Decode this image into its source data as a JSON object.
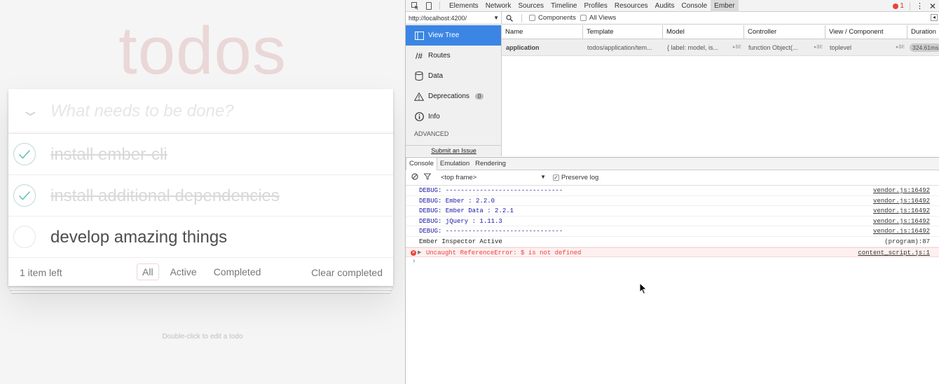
{
  "todo": {
    "title": "todos",
    "new_placeholder": "What needs to be done?",
    "items": [
      {
        "label": "install ember-cli",
        "completed": true
      },
      {
        "label": "install additional dependencies",
        "completed": true
      },
      {
        "label": "develop amazing things",
        "completed": false
      }
    ],
    "items_left": "1 item left",
    "filters": [
      "All",
      "Active",
      "Completed"
    ],
    "selected_filter": "All",
    "clear_completed": "Clear completed",
    "info": "Double-click to edit a todo"
  },
  "devtools": {
    "tabs": [
      "Elements",
      "Network",
      "Sources",
      "Timeline",
      "Profiles",
      "Resources",
      "Audits",
      "Console",
      "Ember"
    ],
    "active_tab": "Ember",
    "error_count": "1",
    "ember": {
      "url": "http://localhost:4200/",
      "components_label": "Components",
      "all_views_label": "All Views",
      "sidebar": [
        {
          "label": "View Tree",
          "icon": "view-tree-icon"
        },
        {
          "label": "Routes",
          "icon": "routes-icon"
        },
        {
          "label": "Data",
          "icon": "data-icon"
        },
        {
          "label": "Deprecations",
          "icon": "warning-icon",
          "badge": "0"
        },
        {
          "label": "Info",
          "icon": "info-icon"
        }
      ],
      "advanced_label": "ADVANCED",
      "submit_issue": "Submit an Issue",
      "columns": [
        "Name",
        "Template",
        "Model",
        "Controller",
        "View / Component",
        "Duration"
      ],
      "rows": [
        {
          "name": "application",
          "template": "todos/application/tem...",
          "model": "{ label: model, is...",
          "controller": "function Object(...",
          "view": "toplevel",
          "duration": "324.61ms",
          "se": "$E"
        }
      ]
    },
    "console": {
      "tabs": [
        "Console",
        "Emulation",
        "Rendering"
      ],
      "frame": "<top frame>",
      "preserve_log": "Preserve log",
      "lines": [
        {
          "text": "DEBUG: -------------------------------",
          "src": "vendor.js:16492",
          "type": "debug"
        },
        {
          "text": "DEBUG: Ember      : 2.2.0",
          "src": "vendor.js:16492",
          "type": "debug"
        },
        {
          "text": "DEBUG: Ember Data : 2.2.1",
          "src": "vendor.js:16492",
          "type": "debug"
        },
        {
          "text": "DEBUG: jQuery     : 1.11.3",
          "src": "vendor.js:16492",
          "type": "debug"
        },
        {
          "text": "DEBUG: -------------------------------",
          "src": "vendor.js:16492",
          "type": "debug"
        },
        {
          "text": "Ember Inspector Active",
          "src": "(program):87",
          "type": "plain"
        },
        {
          "text": "Uncaught ReferenceError: $ is not defined",
          "src": "content_script.js:1",
          "type": "error"
        }
      ],
      "prompt": "›"
    }
  }
}
